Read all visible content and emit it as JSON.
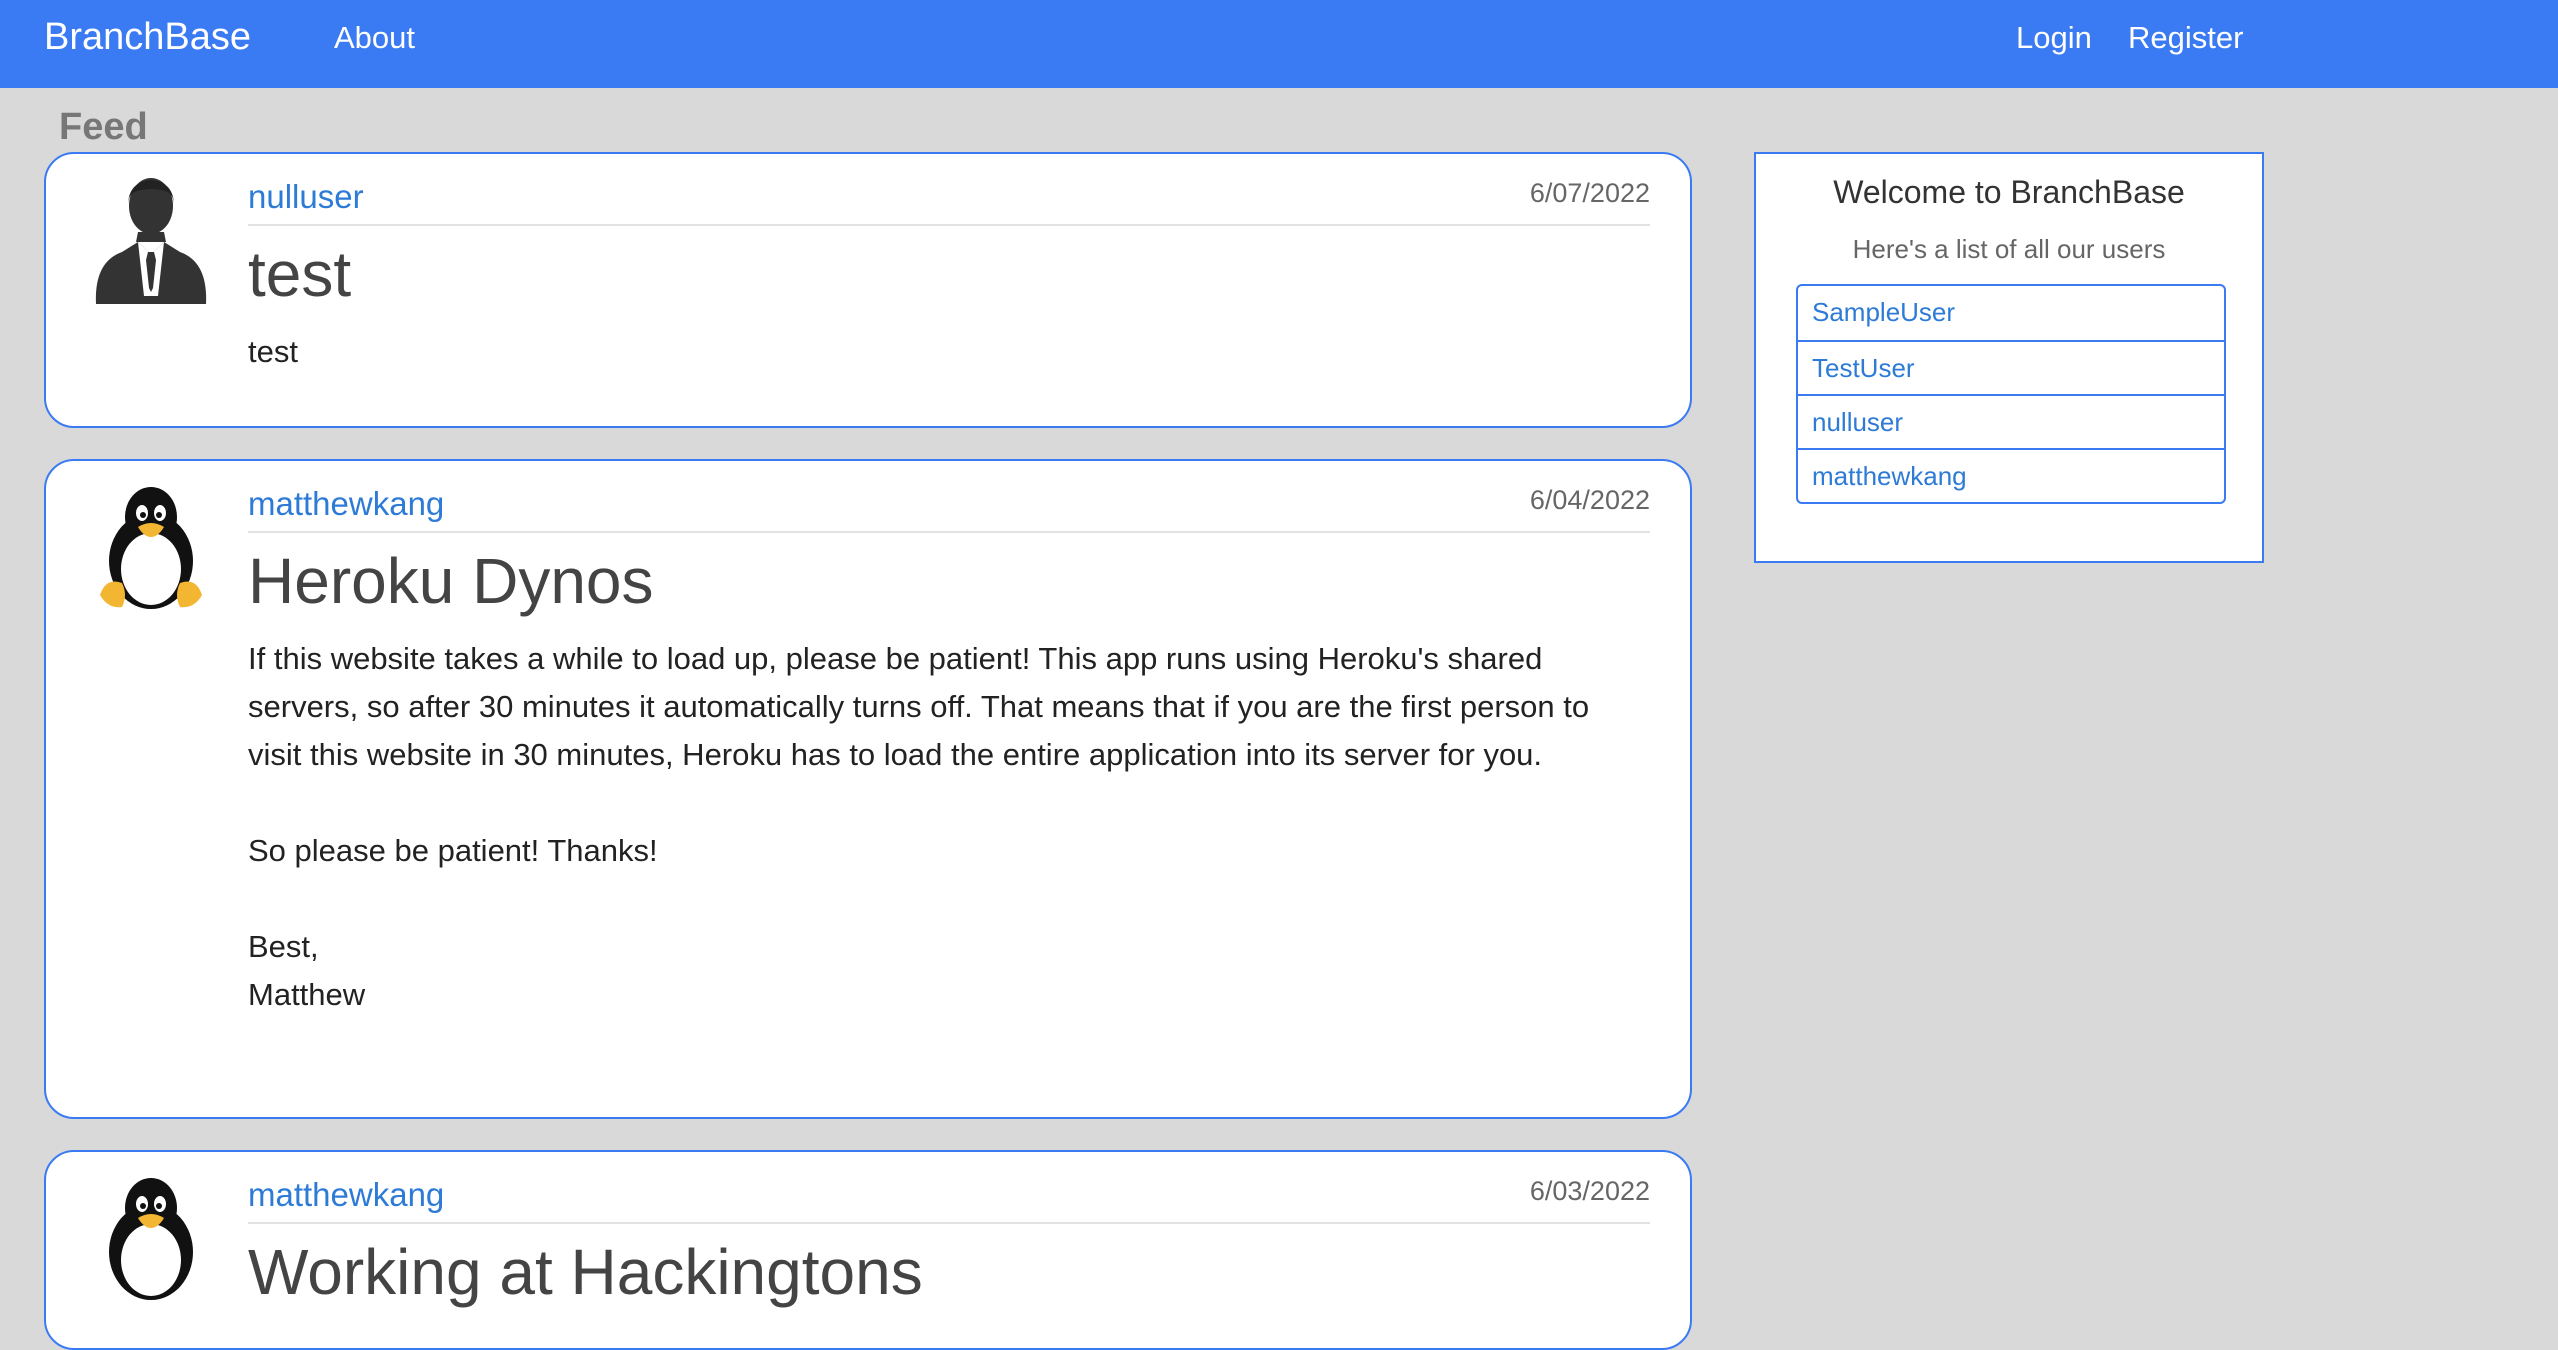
{
  "nav": {
    "brand": "BranchBase",
    "about": "About",
    "login": "Login",
    "register": "Register",
    "background_color": "#3a7af3"
  },
  "feed": {
    "heading": "Feed",
    "posts": [
      {
        "username": "nulluser",
        "date": "6/07/2022",
        "title": "test",
        "body": "test",
        "avatar": "business-person-silhouette-icon"
      },
      {
        "username": "matthewkang",
        "date": "6/04/2022",
        "title": "Heroku Dynos",
        "body": "If this website takes a while to load up, please be patient! This app runs using Heroku's shared servers, so after 30 minutes it automatically turns off. That means that if you are the first person to visit this website in 30 minutes, Heroku has to load the entire application into its server for you.\n\nSo please be patient! Thanks!\n\nBest,\nMatthew",
        "avatar": "tux-penguin-icon"
      },
      {
        "username": "matthewkang",
        "date": "6/03/2022",
        "title": "Working at Hackingtons",
        "body": "",
        "avatar": "tux-penguin-icon"
      }
    ]
  },
  "sidebar": {
    "title": "Welcome to BranchBase",
    "subtitle": "Here's a list of all our users",
    "users": [
      "SampleUser",
      "TestUser",
      "nulluser",
      "matthewkang"
    ]
  }
}
